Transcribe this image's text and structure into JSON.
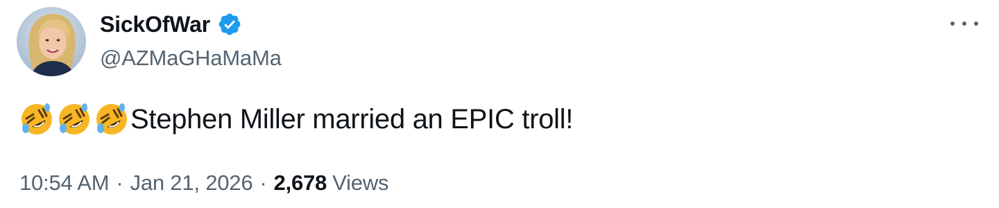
{
  "author": {
    "display_name": "SickOfWar",
    "handle": "@AZMaGHaMaMa",
    "verified": true,
    "verified_color": "#1d9bf0",
    "avatar_icon": "user-avatar-photo"
  },
  "menu": {
    "icon": "more-horizontal-icon"
  },
  "tweet": {
    "emojis": [
      "🤣",
      "🤣",
      "🤣"
    ],
    "text": "Stephen Miller married an EPIC troll!"
  },
  "meta": {
    "time": "10:54 AM",
    "separator": "·",
    "date": "Jan 21, 2026",
    "views_count": "2,678",
    "views_label": "Views"
  },
  "colors": {
    "text_primary": "#0f1419",
    "text_secondary": "#536471",
    "background": "#ffffff"
  }
}
